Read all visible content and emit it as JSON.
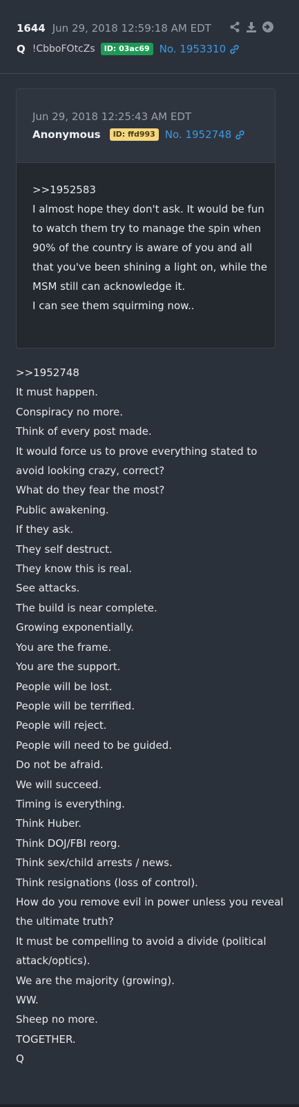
{
  "post": {
    "number": "1644",
    "date": "Jun 29, 2018 12:59:18 AM EDT",
    "author": "Q",
    "tripcode": "!CbboFOtcZs",
    "id_badge": "ID: 03ac69",
    "post_no": "No. 1953310"
  },
  "quoted": {
    "date": "Jun 29, 2018 12:25:43 AM EDT",
    "author": "Anonymous",
    "id_badge": "ID: ffd993",
    "post_no": "No. 1952748",
    "lines": [
      ">>1952583",
      "I almost hope they don't ask. It would be fun to watch them try to manage the spin when 90% of the country is aware of you and all that you've been shining a light on, while the MSM still can acknowledge it.",
      "I can see them squirming now.."
    ]
  },
  "body_lines": [
    ">>1952748",
    "It must happen.",
    "Conspiracy no more.",
    "Think of every post made.",
    "It would force us to prove everything stated to avoid looking crazy, correct?",
    "What do they fear the most?",
    "Public awakening.",
    "If they ask.",
    "They self destruct.",
    "They know this is real.",
    "See attacks.",
    "The build is near complete.",
    "Growing exponentially.",
    "You are the frame.",
    "You are the support.",
    "People will be lost.",
    "People will be terrified.",
    "People will reject.",
    "People will need to be guided.",
    "Do not be afraid.",
    "We will succeed.",
    "Timing is everything.",
    "Think Huber.",
    "Think DOJ/FBI reorg.",
    "Think sex/child arrests / news.",
    "Think resignations (loss of control).",
    "How do you remove evil in power unless you reveal the ultimate truth?",
    "It must be compelling to avoid a divide (political attack/optics).",
    "We are the majority (growing).",
    "WW.",
    "Sheep no more.",
    "TOGETHER.",
    "Q"
  ],
  "icons": {
    "share": "share-icon",
    "download": "download-icon",
    "forward": "arrow-circle-right-icon",
    "link": "link-icon"
  },
  "colors": {
    "background": "#2b313b",
    "link": "#3d99e0",
    "id_green": "#1f9a55",
    "id_yellow": "#f6d77f"
  }
}
